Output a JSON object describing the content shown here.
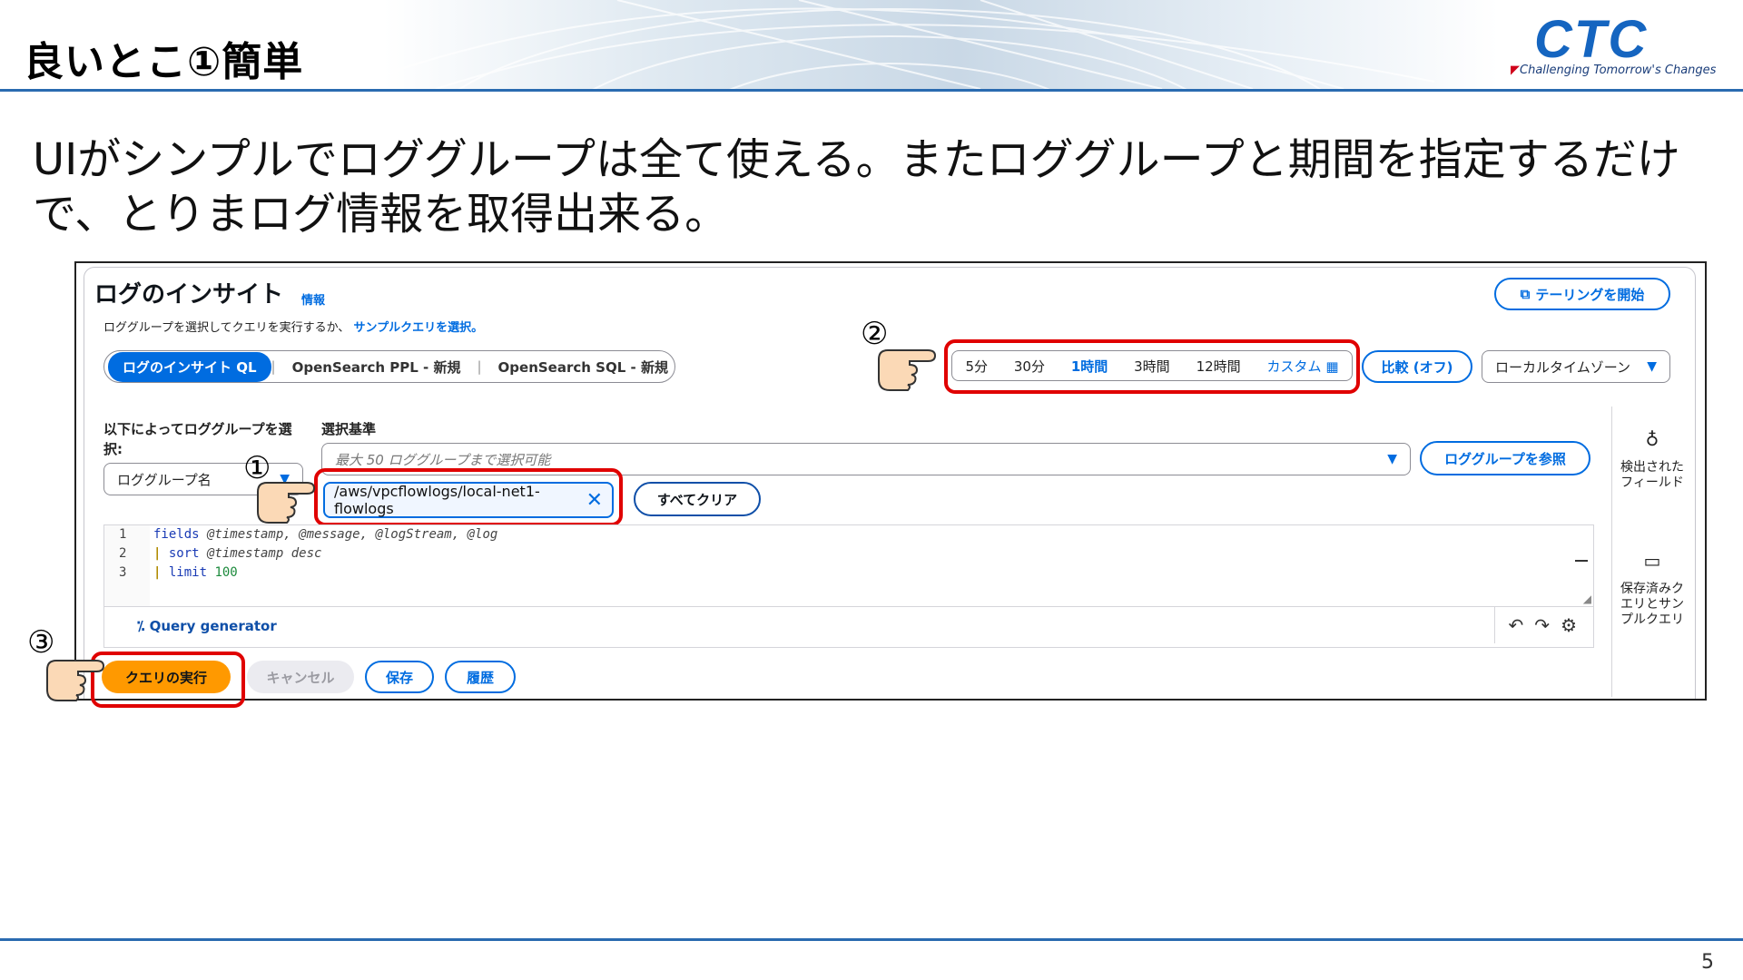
{
  "slide": {
    "title": "良いとこ①簡単",
    "body": "UIがシンプルでロググループは全て使える。またロググループと期間を指定するだけで、とりまログ情報を取得出来る。",
    "page_number": "5",
    "logo": {
      "mark": "CTC",
      "tagline": "Challenging Tomorrow's Changes"
    },
    "annotations": [
      "①",
      "②",
      "③"
    ]
  },
  "console": {
    "title": "ログのインサイト",
    "info_link": "情報",
    "description": "ロググループを選択してクエリを実行するか、",
    "sample_link": "サンプルクエリを選択。",
    "tailing_button": "テーリングを開始",
    "query_language_tabs": [
      "ログのインサイト QL",
      "OpenSearch PPL - 新規",
      "OpenSearch SQL - 新規"
    ],
    "time_range": {
      "options": [
        "5分",
        "30分",
        "1時間",
        "3時間",
        "12時間"
      ],
      "selected": "1時間",
      "custom": "カスタム"
    },
    "compare_button": "比較 (オフ)",
    "timezone": "ローカルタイムゾーン",
    "select_by_label": "以下によってロググループを選択:",
    "select_by_value": "ロググループ名",
    "criteria_label": "選択基準",
    "criteria_placeholder": "最大 50 ロググループまで選択可能",
    "browse_button": "ロググループを参照",
    "selected_group": "/aws/vpcflowlogs/local-net1-flowlogs",
    "clear_all_button": "すべてクリア",
    "query_lines": [
      {
        "num": "1",
        "cmd": "fields",
        "rest": " @timestamp, @message, @logStream, @log"
      },
      {
        "num": "2",
        "cmd": "sort",
        "rest": " @timestamp desc"
      },
      {
        "num": "3",
        "cmd": "limit",
        "rest": " 100"
      }
    ],
    "query_generator": "Query generator",
    "run_button": "クエリの実行",
    "cancel_button": "キャンセル",
    "save_button": "保存",
    "history_button": "履歴",
    "side_panel": [
      "検出されたフィールド",
      "保存済みクエリとサンプルクエリ"
    ],
    "accent_color": "#006ce0",
    "run_color": "#ff9900",
    "highlight_color": "#e00000"
  }
}
